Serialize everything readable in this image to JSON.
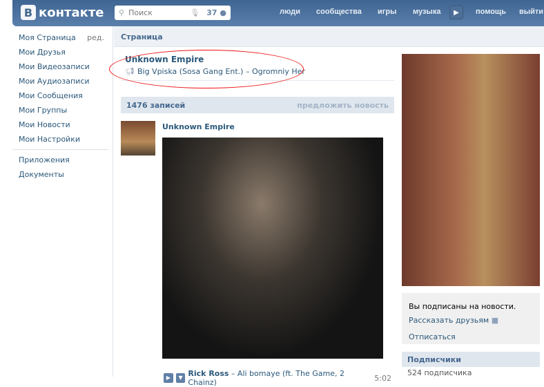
{
  "header": {
    "logo_letter": "В",
    "logo_text": "контакте",
    "search_placeholder": "Поиск",
    "search_count": "37",
    "nav": [
      "люди",
      "сообщества",
      "игры",
      "музыка",
      "помощь",
      "выйти"
    ]
  },
  "sidebar": {
    "items": [
      {
        "label": "Моя Страница",
        "extra": "ред."
      },
      {
        "label": "Мои Друзья"
      },
      {
        "label": "Мои Видеозаписи"
      },
      {
        "label": "Мои Аудиозаписи"
      },
      {
        "label": "Мои Сообщения"
      },
      {
        "label": "Мои Группы"
      },
      {
        "label": "Мои Новости"
      },
      {
        "label": "Мои Настройки"
      }
    ],
    "items2": [
      {
        "label": "Приложения"
      },
      {
        "label": "Документы"
      }
    ]
  },
  "breadcrumb": "Страница",
  "page": {
    "title": "Unknown Empire",
    "status": "Big Vpiska (Sosa Gang Ent.) – Ogromniy Her"
  },
  "wall": {
    "count": "1476 записей",
    "suggest": "предложить новость",
    "post": {
      "author": "Unknown Empire",
      "audio_artist": "Rick Ross",
      "audio_title": " – Ali bomaye (ft. The Game, 2 Chainz)",
      "audio_time": "5:02"
    }
  },
  "right": {
    "subscribed": "Вы подписаны на новости.",
    "tell": "Рассказать друзьям",
    "unsubscribe": "Отписаться",
    "followers_title": "Подписчики",
    "followers_count": "524 подписчика"
  }
}
